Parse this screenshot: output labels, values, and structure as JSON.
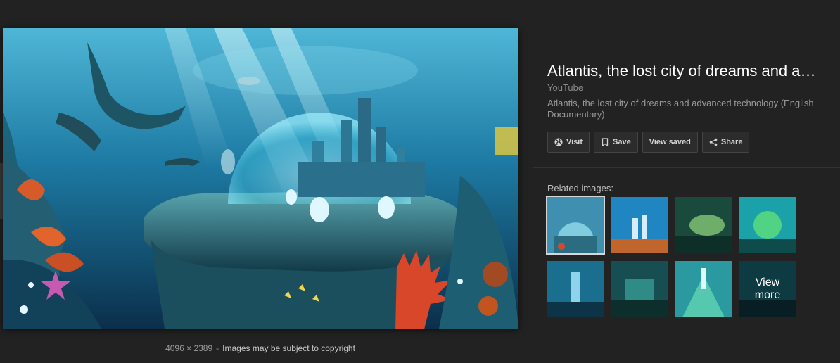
{
  "caption": {
    "dimensions": "4096 × 2389",
    "separator": "-",
    "copyright": "Images may be subject to copyright"
  },
  "panel": {
    "title": "Atlantis, the lost city of dreams and a…",
    "source": "YouTube",
    "description": "Atlantis, the lost city of dreams and advanced technology (English Documentary)",
    "actions": [
      {
        "label": "Visit",
        "icon": "globe-icon"
      },
      {
        "label": "Save",
        "icon": "bookmark-icon"
      },
      {
        "label": "View saved",
        "icon": ""
      },
      {
        "label": "Share",
        "icon": "share-icon"
      }
    ]
  },
  "related": {
    "label": "Related images:",
    "more_line1": "View",
    "more_line2": "more"
  },
  "colors": {
    "background": "#222222",
    "title": "#ffffff",
    "button_bg": "#2c2c2c"
  }
}
